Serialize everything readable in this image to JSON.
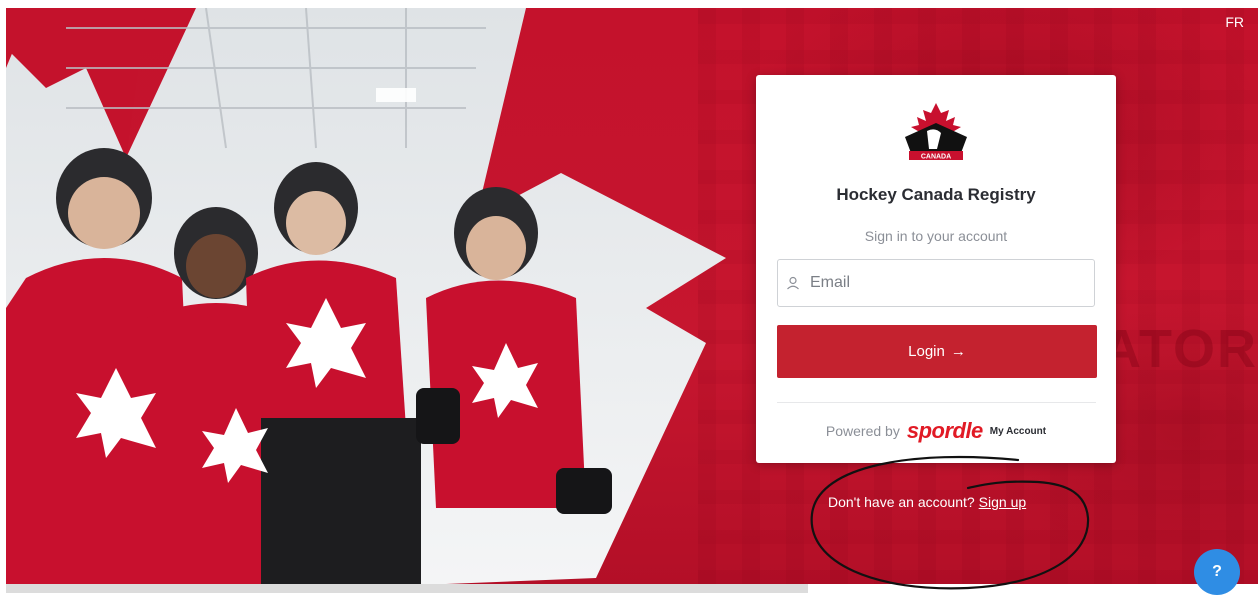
{
  "header": {
    "language_toggle": "FR"
  },
  "card": {
    "title": "Hockey Canada Registry",
    "subtitle": "Sign in to your account",
    "email_placeholder": "Email",
    "email_value": "",
    "login_label": "Login",
    "login_arrow": "→",
    "powered_by": "Powered by",
    "brand": "spordle",
    "brand_suffix": "My Account",
    "logo_text": "CANADA"
  },
  "footer": {
    "signup_prompt": "Don't have an account?",
    "signup_link": "Sign up",
    "help_label": "?"
  },
  "background": {
    "banner_text": "VRO   GATOR"
  },
  "colors": {
    "brand_red": "#c4122c",
    "button_red": "#c4222f",
    "spordle_red": "#e11a25",
    "help_blue": "#2f8de4"
  }
}
